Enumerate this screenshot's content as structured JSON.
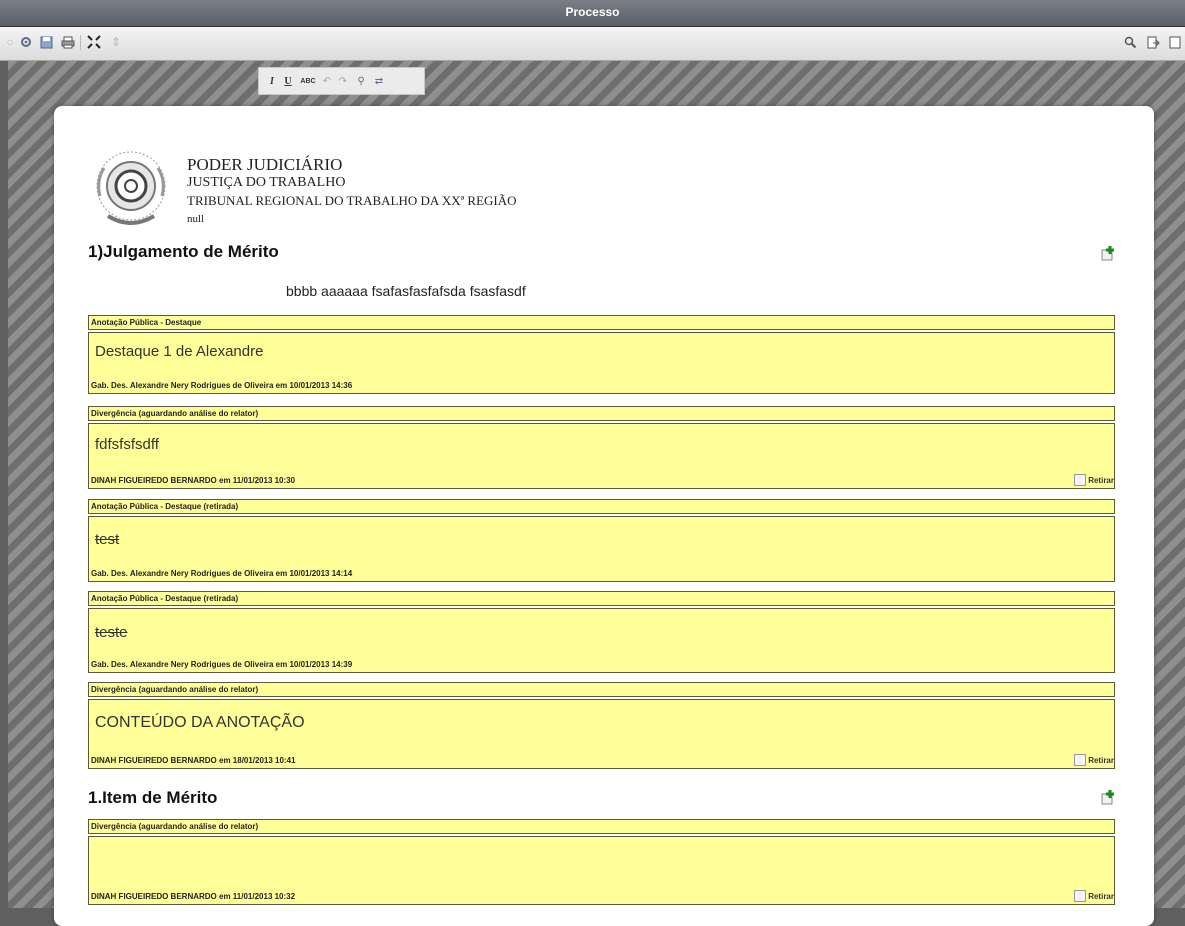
{
  "window": {
    "title": "Processo"
  },
  "toolbar": {
    "left_icons": [
      "circle-icon",
      "gear-icon",
      "save-icon",
      "print-icon",
      "fullscreen-icon",
      "resize-icon"
    ],
    "right_icons": [
      "search-icon",
      "export-icon",
      "document-icon"
    ]
  },
  "format_toolbar": {
    "italic": "I",
    "underline": "U",
    "spellcheck": "ABC",
    "undo": "↶",
    "redo": "↷",
    "find": "⚲",
    "replace": "⇄"
  },
  "letterhead": {
    "line1": "PODER JUDICIÁRIO",
    "line2": "JUSTIÇA DO TRABALHO",
    "line3": "TRIBUNAL REGIONAL DO TRABALHO DA XXª REGIÃO",
    "line4": "null"
  },
  "sections": {
    "s1": {
      "title": "1)Julgamento de Mérito",
      "body": "bbbb aaaaaa fsafasfasfafsda fsasfasdf"
    },
    "s2": {
      "title": "1.Item de Mérito"
    }
  },
  "notes": [
    {
      "header": "Anotação Pública - Destaque",
      "content": "Destaque 1 de Alexandre",
      "footer": "Gab. Des. Alexandre Nery Rodrigues de Oliveira em 10/01/2013 14:36",
      "retirar": ""
    },
    {
      "header": "Divergência (aguardando análise do relator)",
      "content": "fdfsfsfsdff",
      "footer": "DINAH FIGUEIREDO BERNARDO em 11/01/2013 10:30",
      "retirar": "Retirar"
    },
    {
      "header": "Anotação Pública - Destaque (retirada)",
      "content": "test",
      "footer": "Gab. Des. Alexandre Nery Rodrigues de Oliveira em 10/01/2013 14:14",
      "retirar": ""
    },
    {
      "header": "Anotação Pública - Destaque (retirada)",
      "content": "teste",
      "footer": "Gab. Des. Alexandre Nery Rodrigues de Oliveira em 10/01/2013 14:39",
      "retirar": ""
    },
    {
      "header": "Divergência (aguardando análise do relator)",
      "content": "CONTEÚDO DA ANOTAÇÃO",
      "footer": "DINAH FIGUEIREDO BERNARDO em 18/01/2013 10:41",
      "retirar": "Retirar"
    },
    {
      "header": "Divergência (aguardando análise do relator)",
      "content": "",
      "footer": "DINAH FIGUEIREDO BERNARDO em 11/01/2013 10:32",
      "retirar": "Retirar"
    }
  ]
}
